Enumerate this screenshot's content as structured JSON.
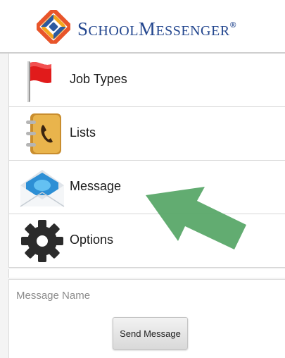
{
  "header": {
    "brand_big_1": "S",
    "brand_small_1": "CHOOL",
    "brand_big_2": "M",
    "brand_small_2": "ESSENGER",
    "brand_mark": "®"
  },
  "menu": {
    "items": [
      {
        "label": "Job Types",
        "icon": "red-flag-icon"
      },
      {
        "label": "Lists",
        "icon": "address-book-icon"
      },
      {
        "label": "Message",
        "icon": "envelope-icon"
      },
      {
        "label": "Options",
        "icon": "gear-icon"
      }
    ]
  },
  "message_name": {
    "value": "",
    "placeholder": "Message Name"
  },
  "send_button": {
    "label": "Send Message"
  },
  "annotation": {
    "arrow_color": "#5aa869"
  },
  "colors": {
    "brand": "#24478f"
  }
}
